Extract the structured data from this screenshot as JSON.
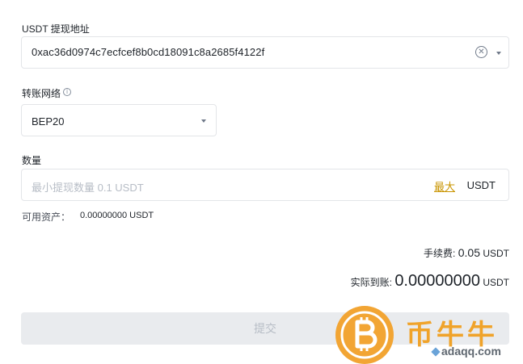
{
  "address": {
    "label": "USDT 提现地址",
    "value": "0xac36d0974c7ecfcef8b0cd18091c8a2685f4122f",
    "clear_icon": "clear-circle-icon",
    "dropdown_icon": "caret-down-icon"
  },
  "network": {
    "label": "转账网络",
    "info_icon": "info-icon",
    "selected": "BEP20",
    "dropdown_icon": "caret-down-icon"
  },
  "amount": {
    "label": "数量",
    "placeholder": "最小提现数量 0.1 USDT",
    "max_label": "最大",
    "unit": "USDT",
    "available_label": "可用资产：",
    "available_value": "0.00000000 USDT"
  },
  "summary": {
    "fee_label": "手续费:",
    "fee_value": "0.05",
    "fee_unit": "USDT",
    "receive_label": "实际到账:",
    "receive_value": "0.00000000",
    "receive_unit": "USDT"
  },
  "submit_label": "提交",
  "watermark": {
    "brand": "币牛牛",
    "site": "adaqq.com"
  },
  "colors": {
    "accent": "#c99400",
    "disabled_button": "#e9ebee",
    "watermark_orange": "#f0a32a"
  }
}
